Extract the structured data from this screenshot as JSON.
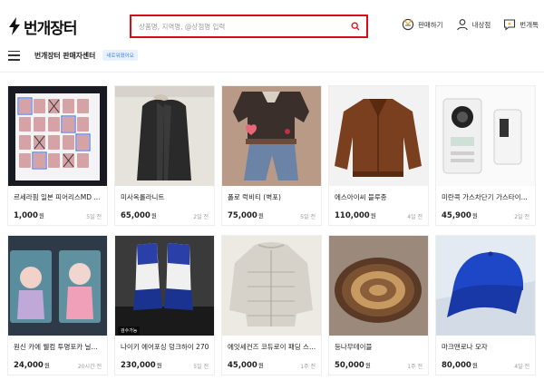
{
  "header": {
    "logo_text": "번개장터",
    "search_placeholder": "상품명, 지역명, @상점명 입력",
    "actions": [
      {
        "label": "판매하기",
        "icon": "won-coin-icon"
      },
      {
        "label": "내상점",
        "icon": "user-icon"
      },
      {
        "label": "번개톡",
        "icon": "chat-bolt-icon"
      }
    ]
  },
  "subnav": {
    "seller_center": "번개장터 판매자센터",
    "badge": "새로워졌어요"
  },
  "products": [
    {
      "title": "르세라핌 일본 피어리스MD ...",
      "price": "1,000",
      "unit": "원",
      "ago": "5일 전",
      "image": "photocard-grid"
    },
    {
      "title": "미사옥롤라니트",
      "price": "65,000",
      "unit": "원",
      "ago": "2일 전",
      "image": "long-cardigan"
    },
    {
      "title": "폴로 럭비티 (벽포)",
      "price": "75,000",
      "unit": "원",
      "ago": "5일 전",
      "image": "rugby-shirt"
    },
    {
      "title": "에스아이씨 블루종",
      "price": "110,000",
      "unit": "원",
      "ago": "4일 전",
      "image": "corduroy-jacket"
    },
    {
      "title": "미란콕 가스차단기 가스타이...",
      "price": "45,900",
      "unit": "원",
      "ago": "2일 전",
      "image": "gas-timer"
    },
    {
      "title": "원신 카에 웰컴 투명포카 닐...",
      "price": "24,000",
      "unit": "원",
      "ago": "20시간 전",
      "image": "clear-cards"
    },
    {
      "title": "나이키 에어포싱 덩크하이 270",
      "price": "230,000",
      "unit": "원",
      "ago": "5일 전",
      "image": "sneakers",
      "tag": "검수가능"
    },
    {
      "title": "에잇세컨즈 코듀로이 패딩 스...",
      "price": "45,000",
      "unit": "원",
      "ago": "1주 전",
      "image": "puffer-jacket"
    },
    {
      "title": "등나무테이블",
      "price": "50,000",
      "unit": "원",
      "ago": "1주 전",
      "image": "rattan-table"
    },
    {
      "title": "마크맨로나 모자",
      "price": "80,000",
      "unit": "원",
      "ago": "4일 전",
      "image": "blue-cap"
    }
  ],
  "colors": {
    "accent": "#d80c18",
    "badge_bg": "#e8f2ff",
    "badge_text": "#3c82f0"
  }
}
